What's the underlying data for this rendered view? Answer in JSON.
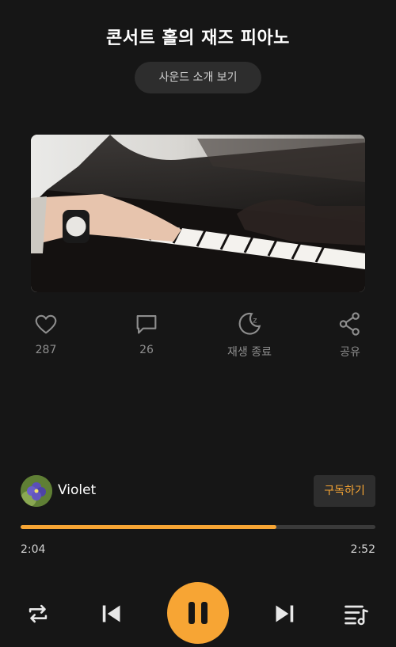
{
  "header": {
    "title": "콘서트 홀의 재즈 피아노",
    "intro_button": "사운드 소개 보기"
  },
  "actions": {
    "like": {
      "icon": "heart-icon",
      "label": "287"
    },
    "comment": {
      "icon": "comment-icon",
      "label": "26"
    },
    "sleep_timer": {
      "icon": "moon-icon",
      "label": "재생 종료"
    },
    "share": {
      "icon": "share-icon",
      "label": "공유"
    }
  },
  "author": {
    "name": "Violet",
    "subscribe_label": "구독하기"
  },
  "player": {
    "current_time": "2:04",
    "total_time": "2:52",
    "progress": 0.72
  },
  "colors": {
    "accent": "#f7a534",
    "background": "#161616"
  },
  "controls": {
    "repeat": "repeat-icon",
    "previous": "skip-previous-icon",
    "play_pause": "pause-icon",
    "next": "skip-next-icon",
    "playlist": "playlist-icon"
  }
}
